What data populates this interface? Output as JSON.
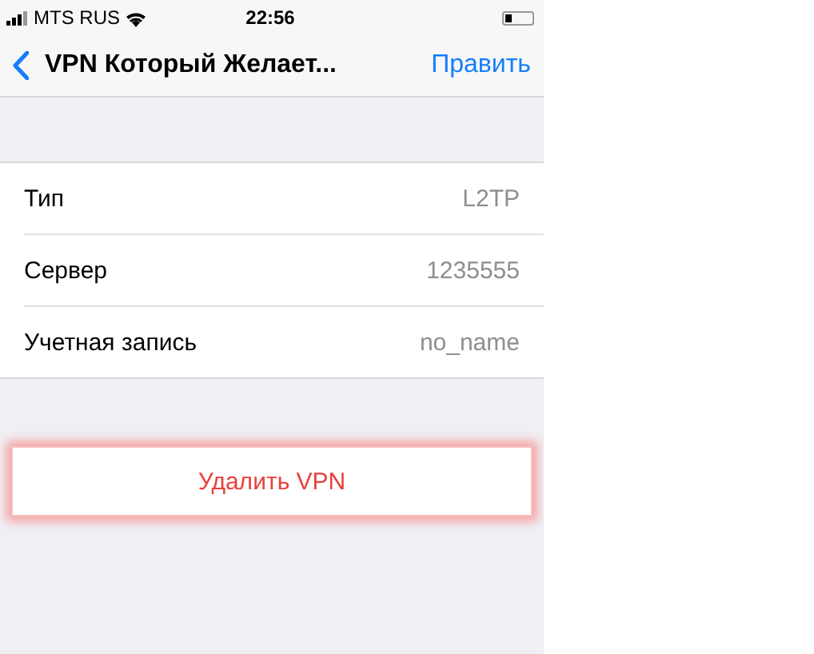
{
  "status_bar": {
    "carrier": "MTS RUS",
    "time": "22:56"
  },
  "nav_bar": {
    "title": "VPN Который Желает...",
    "action": "Править"
  },
  "rows": [
    {
      "label": "Тип",
      "value": "L2TP"
    },
    {
      "label": "Сервер",
      "value": "1235555"
    },
    {
      "label": "Учетная запись",
      "value": "no_name"
    }
  ],
  "delete_button": {
    "label": "Удалить VPN",
    "highlighted": true
  }
}
